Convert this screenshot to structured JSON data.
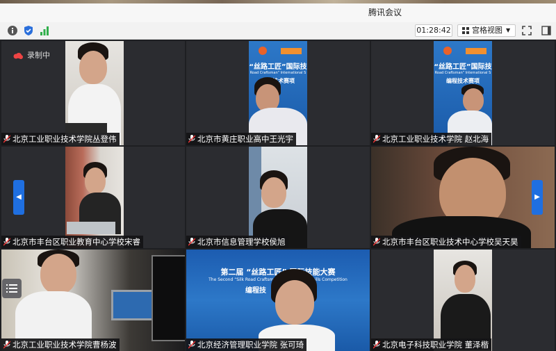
{
  "window": {
    "title": "腾讯会议"
  },
  "toolbar": {
    "timer": "01:28:42",
    "view_label": "宫格视图",
    "icons": [
      "info-icon",
      "shield-icon",
      "signal-icon",
      "grid-icon",
      "fullscreen-icon",
      "sidebar-toggle-icon"
    ]
  },
  "recording": {
    "label": "录制中"
  },
  "participants": [
    {
      "name": "北京工业职业技术学院丛登伟"
    },
    {
      "name": "北京市黄庄职业高中王光宇"
    },
    {
      "name": "北京工业职业技术学院 赵北海"
    },
    {
      "name": "北京市丰台区职业教育中心学校宋睿"
    },
    {
      "name": "北京市信息管理学校侯旭"
    },
    {
      "name": "北京市丰台区职业技术中心学校吴天昊"
    },
    {
      "name": "北京工业职业技术学院曹杨波"
    },
    {
      "name": "北京经济管理职业学院 张可琦"
    },
    {
      "name": "北京电子科技职业学院 董泽楷"
    }
  ],
  "posters": {
    "small_title": "“丝路工匠”国际技",
    "small_sub": "Road Craftsman” International S",
    "small_event": "编程技术赛项",
    "big_title": "第二届 “丝路工匠” 国际技能大赛",
    "big_sub": "The Second “Silk Road Craftsman” International Skills Competition",
    "big_event": "编程技"
  },
  "colors": {
    "accent": "#1f6fe0",
    "tile_bg": "#2b2c30",
    "nameplate_bg": "#141416"
  }
}
